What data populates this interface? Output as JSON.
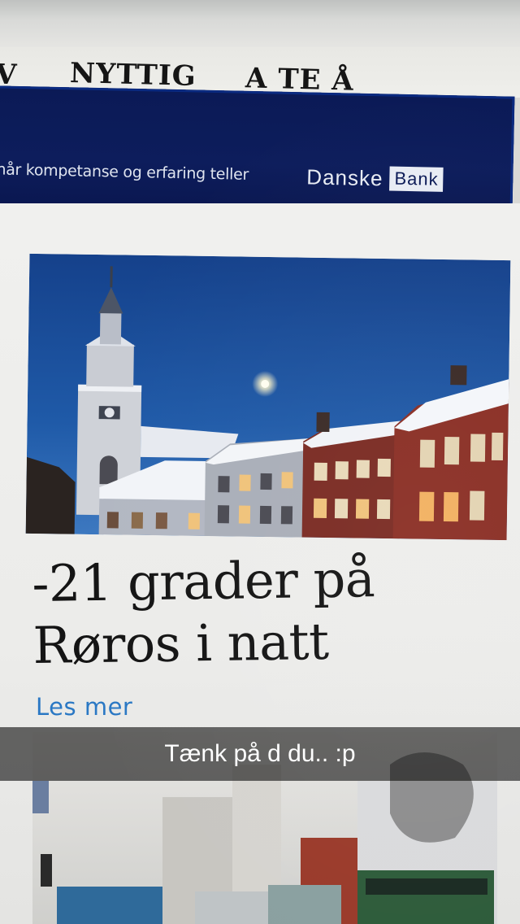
{
  "nav": {
    "items": [
      {
        "label": "V"
      },
      {
        "label": "NYTTIG"
      },
      {
        "label": "A TE Å"
      }
    ]
  },
  "banner": {
    "tagline": "når kompetanse og erfaring teller",
    "logo_word1": "Danske",
    "logo_word2": "Bank"
  },
  "article": {
    "headline_line1": "-21 grader på",
    "headline_line2": "Røros i natt",
    "read_more": "Les mer"
  },
  "overlay": {
    "caption": "Tænk på d du.. :p"
  },
  "colors": {
    "banner_bg": "#0b1a56",
    "link": "#2a78c4",
    "sky": "#1b4f9a"
  }
}
